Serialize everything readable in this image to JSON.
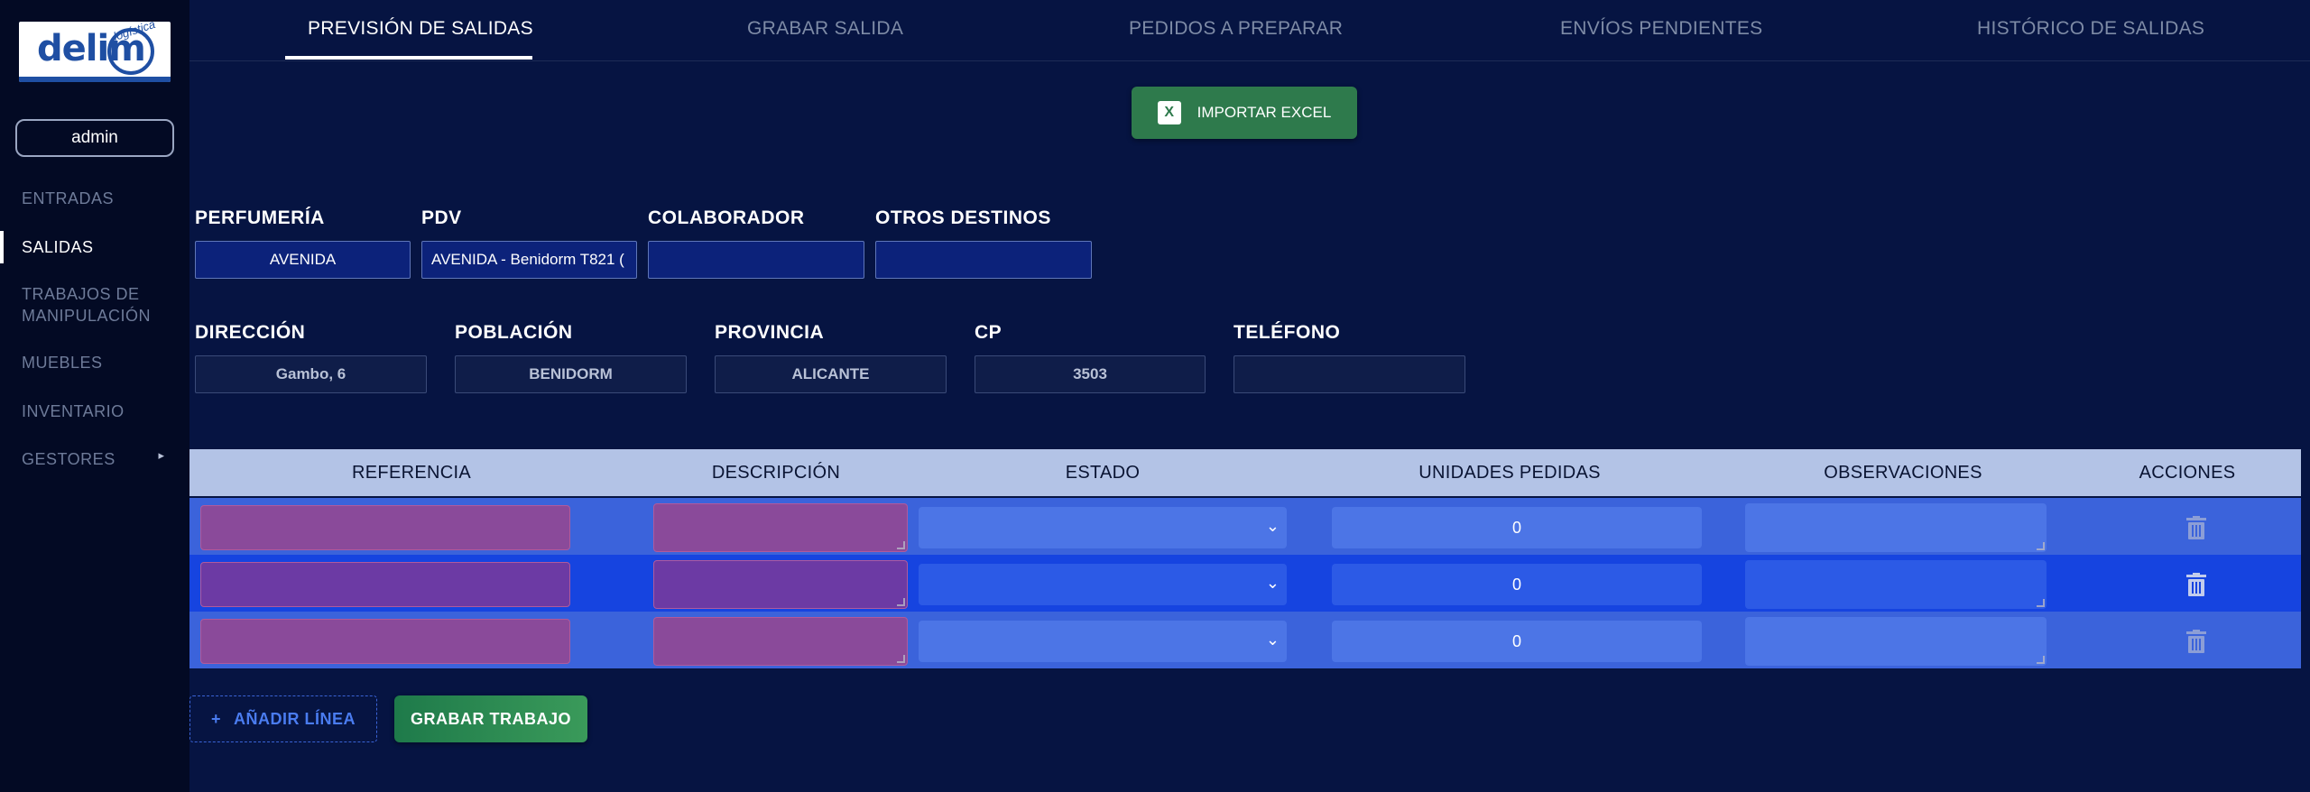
{
  "sidebar": {
    "logo_text": "delim",
    "logo_arc": "logística",
    "user": "admin",
    "items": [
      {
        "label": "ENTRADAS"
      },
      {
        "label": "SALIDAS"
      },
      {
        "label": "TRABAJOS DE MANIPULACIÓN"
      },
      {
        "label": "MUEBLES"
      },
      {
        "label": "INVENTARIO"
      },
      {
        "label": "GESTORES"
      }
    ],
    "arrow": "▸"
  },
  "tabs": [
    {
      "label": "PREVISIÓN DE SALIDAS"
    },
    {
      "label": "GRABAR SALIDA"
    },
    {
      "label": "PEDIDOS A PREPARAR"
    },
    {
      "label": "ENVÍOS PENDIENTES"
    },
    {
      "label": "HISTÓRICO DE SALIDAS"
    }
  ],
  "import_button": {
    "label": "IMPORTAR EXCEL",
    "icon_text": "X"
  },
  "form": {
    "perfumeria": {
      "label": "PERFUMERÍA",
      "value": "AVENIDA"
    },
    "pdv": {
      "label": "PDV",
      "value": "AVENIDA - Benidorm T821 ("
    },
    "colaborador": {
      "label": "COLABORADOR",
      "value": ""
    },
    "otros_destinos": {
      "label": "OTROS DESTINOS",
      "value": ""
    },
    "direccion": {
      "label": "DIRECCIÓN",
      "value": "Gambo, 6"
    },
    "poblacion": {
      "label": "POBLACIÓN",
      "value": "BENIDORM"
    },
    "provincia": {
      "label": "PROVINCIA",
      "value": "ALICANTE"
    },
    "cp": {
      "label": "CP",
      "value": "3503"
    },
    "telefono": {
      "label": "TELÉFONO",
      "value": ""
    }
  },
  "table": {
    "headers": {
      "referencia": "REFERENCIA",
      "descripcion": "DESCRIPCIÓN",
      "estado": "ESTADO",
      "unidades": "UNIDADES PEDIDAS",
      "observaciones": "OBSERVACIONES",
      "acciones": "ACCIONES"
    },
    "rows": [
      {
        "unidades": "0"
      },
      {
        "unidades": "0"
      },
      {
        "unidades": "0"
      }
    ],
    "select_chevron": "⌄"
  },
  "bottom": {
    "add_icon": "+",
    "add_line": "AÑADIR LÍNEA",
    "save_job": "GRABAR TRABAJO"
  },
  "colors": {
    "background": "#061442",
    "sidebar": "#030a24",
    "import_green": "#2e7a4c",
    "header_row": "#b3c3e6",
    "row_odd": "#3b63db",
    "row_even": "#1644e0",
    "ref_cell": "#8a4a9a"
  }
}
